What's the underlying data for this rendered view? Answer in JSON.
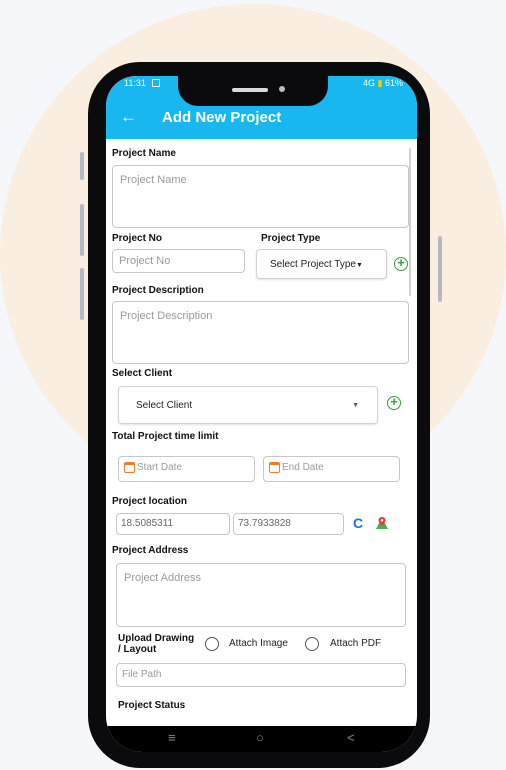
{
  "colors": {
    "appbar": "#18b7ef",
    "accent_green": "#3d9b3d",
    "calendar_orange": "#f07a2c",
    "refresh_blue": "#1a73e8"
  },
  "status_bar": {
    "time": "11:31",
    "signal": "4G",
    "battery_icon": "▮",
    "battery": "61%"
  },
  "app_bar": {
    "back_icon": "←",
    "title": "Add New Project"
  },
  "form": {
    "project_name": {
      "label": "Project Name",
      "placeholder": "Project Name"
    },
    "project_no": {
      "label": "Project No",
      "placeholder": "Project No"
    },
    "project_type": {
      "label": "Project Type",
      "selected": "Select Project Type"
    },
    "project_description": {
      "label": "Project Description",
      "placeholder": "Project Description"
    },
    "select_client": {
      "label": "Select Client",
      "selected": "Select Client"
    },
    "time_limit": {
      "label": "Total Project time limit",
      "start_placeholder": "Start Date",
      "end_placeholder": "End Date"
    },
    "location": {
      "label": "Project location",
      "latitude": "18.5085311",
      "longitude": "73.7933828",
      "refresh_icon": "C"
    },
    "project_address": {
      "label": "Project Address",
      "placeholder": "Project Address"
    },
    "upload": {
      "label_line1": "Upload Drawing",
      "label_line2": "/ Layout",
      "option_image": "Attach Image",
      "option_pdf": "Attach PDF",
      "file_path_placeholder": "File Path"
    },
    "project_status": {
      "label": "Project Status"
    }
  },
  "nav_bar": {
    "menu_icon": "≡",
    "home_icon": "○",
    "back_icon": "<"
  }
}
